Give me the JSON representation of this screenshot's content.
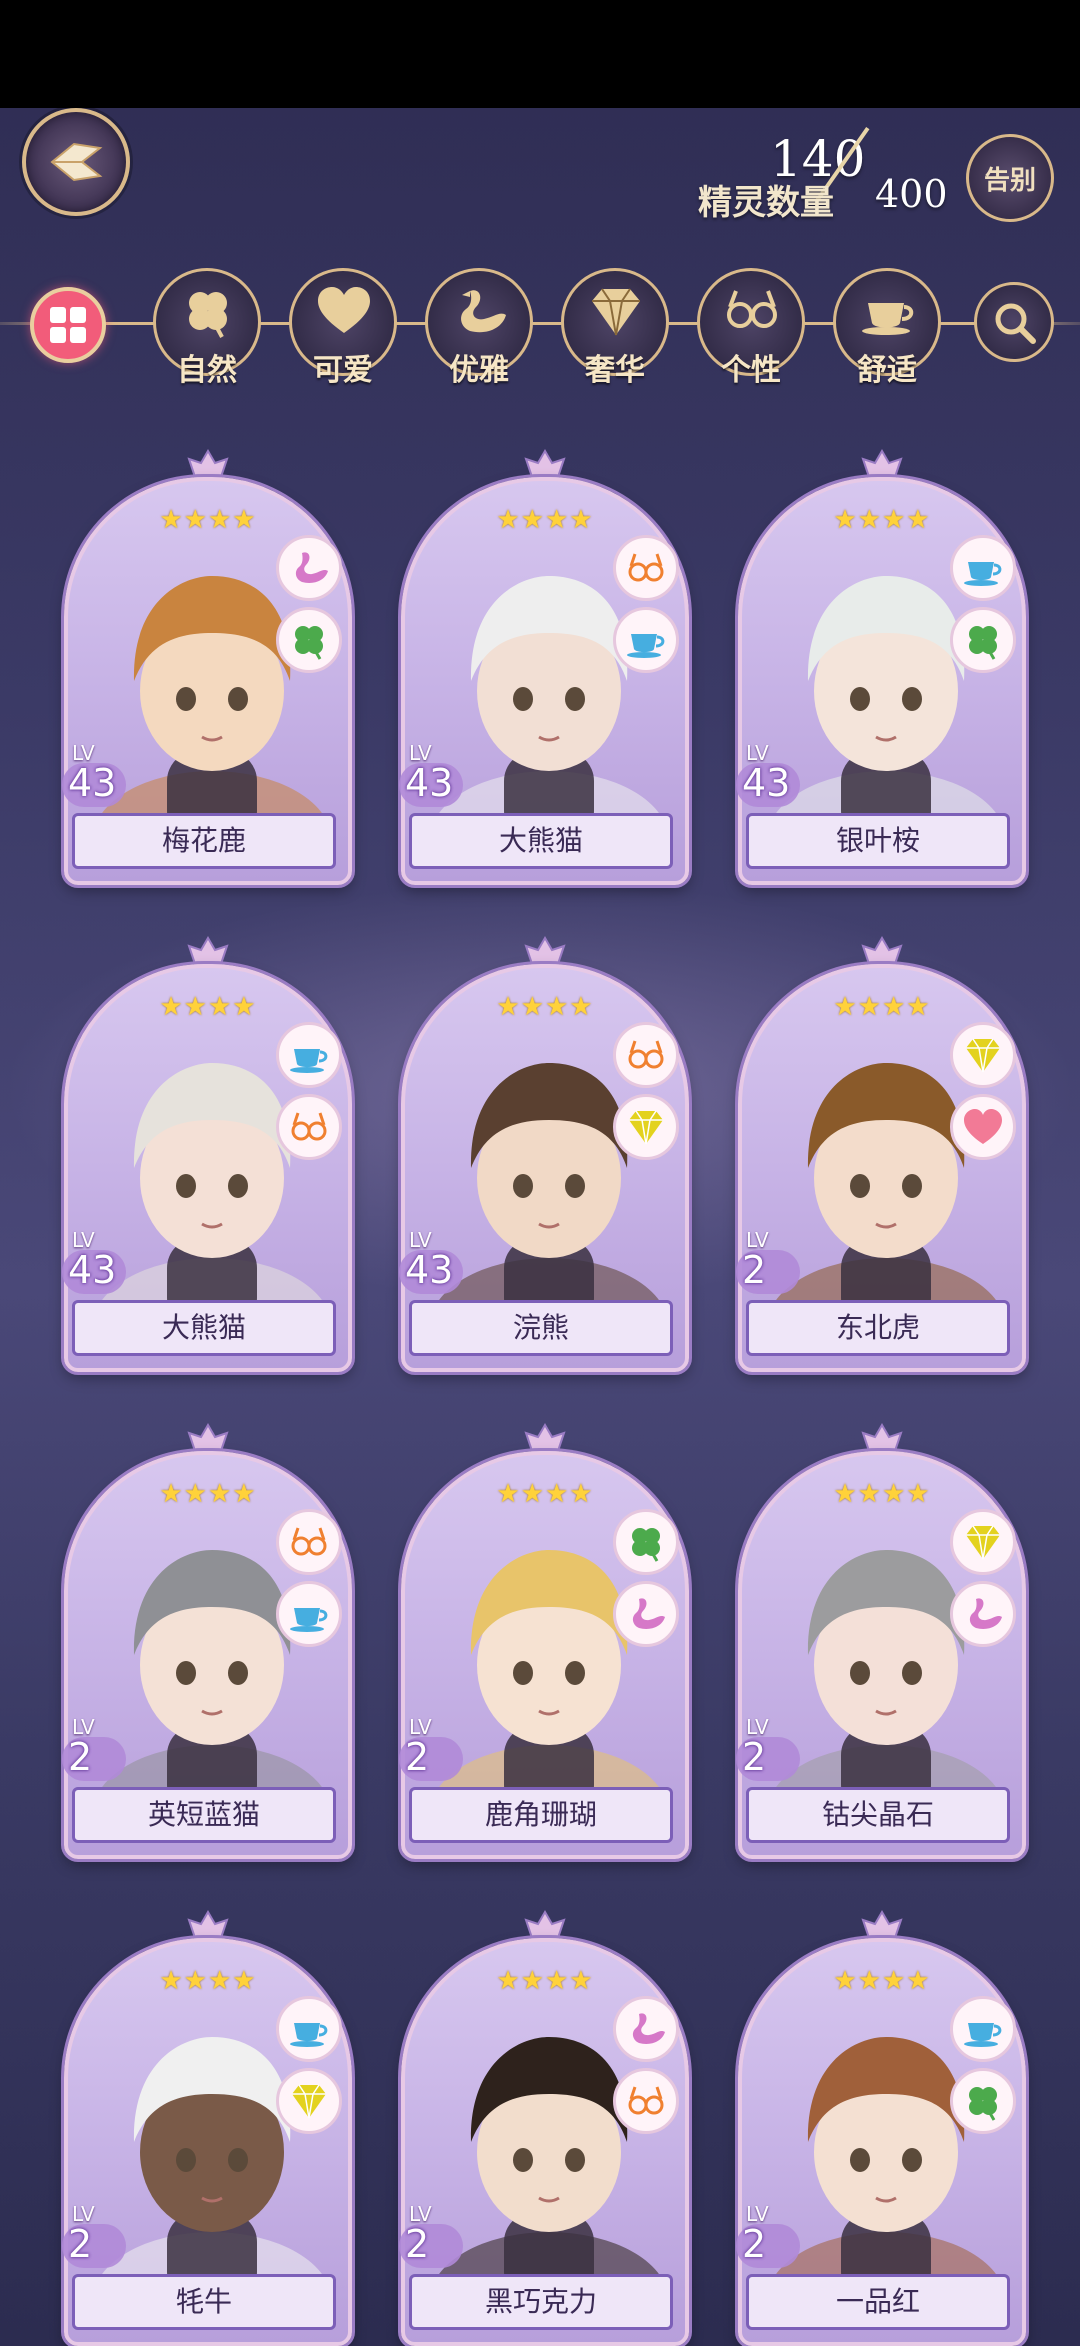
{
  "header": {
    "sprite_count_label": "精灵数量",
    "sprite_count": "140",
    "sprite_max": "400",
    "farewell_label": "告别"
  },
  "filters": {
    "items": [
      {
        "label": "自然",
        "icon": "clover-icon"
      },
      {
        "label": "可爱",
        "icon": "heart-icon"
      },
      {
        "label": "优雅",
        "icon": "swan-icon"
      },
      {
        "label": "奢华",
        "icon": "diamond-icon"
      },
      {
        "label": "个性",
        "icon": "glasses-icon"
      },
      {
        "label": "舒适",
        "icon": "teacup-icon"
      }
    ]
  },
  "colors": {
    "accent_gold": "#d9b98a",
    "filter_all_active": "#f25c7a",
    "card_bg": "#c7b3e6",
    "star": "#ffd23a"
  },
  "cards": [
    {
      "name": "梅花鹿",
      "level_label": "LV",
      "level": "43",
      "stars": "★★★★",
      "badges": [
        "swan-icon",
        "clover-icon"
      ]
    },
    {
      "name": "大熊猫",
      "level_label": "LV",
      "level": "43",
      "stars": "★★★★",
      "badges": [
        "glasses-icon",
        "teacup-icon"
      ]
    },
    {
      "name": "银叶桉",
      "level_label": "LV",
      "level": "43",
      "stars": "★★★★",
      "badges": [
        "teacup-icon",
        "clover-icon"
      ]
    },
    {
      "name": "大熊猫",
      "level_label": "LV",
      "level": "43",
      "stars": "★★★★",
      "badges": [
        "teacup-icon",
        "glasses-icon"
      ]
    },
    {
      "name": "浣熊",
      "level_label": "LV",
      "level": "43",
      "stars": "★★★★",
      "badges": [
        "glasses-icon",
        "diamond-icon"
      ]
    },
    {
      "name": "东北虎",
      "level_label": "LV",
      "level": "2",
      "stars": "★★★★",
      "badges": [
        "diamond-icon",
        "heart-icon"
      ]
    },
    {
      "name": "英短蓝猫",
      "level_label": "LV",
      "level": "2",
      "stars": "★★★★",
      "badges": [
        "glasses-icon",
        "teacup-icon"
      ]
    },
    {
      "name": "鹿角珊瑚",
      "level_label": "LV",
      "level": "2",
      "stars": "★★★★",
      "badges": [
        "clover-icon",
        "swan-icon"
      ]
    },
    {
      "name": "钴尖晶石",
      "level_label": "LV",
      "level": "2",
      "stars": "★★★★",
      "badges": [
        "diamond-icon",
        "swan-icon"
      ]
    },
    {
      "name": "牦牛",
      "level_label": "LV",
      "level": "2",
      "stars": "★★★★",
      "badges": [
        "teacup-icon",
        "diamond-icon"
      ]
    },
    {
      "name": "黑巧克力",
      "level_label": "LV",
      "level": "2",
      "stars": "★★★★",
      "badges": [
        "swan-icon",
        "glasses-icon"
      ]
    },
    {
      "name": "一品红",
      "level_label": "LV",
      "level": "2",
      "stars": "★★★★",
      "badges": [
        "teacup-icon",
        "clover-icon"
      ]
    }
  ]
}
